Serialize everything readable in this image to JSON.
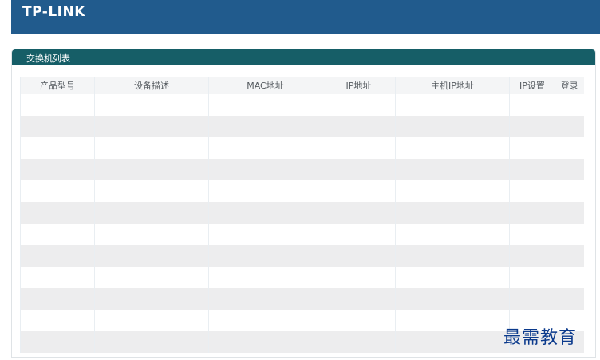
{
  "header": {
    "brand": "TP-LINK",
    "background_color": "#215b8d"
  },
  "panel": {
    "title": "交换机列表",
    "header_color": "#165e67"
  },
  "table": {
    "columns": [
      "产品型号",
      "设备描述",
      "MAC地址",
      "IP地址",
      "主机IP地址",
      "IP设置",
      "登录"
    ],
    "row_count": 12,
    "row_colors": [
      "#ffffff",
      "#ededee"
    ]
  },
  "watermark": {
    "text": "最需教育",
    "color": "#0b3a8c"
  }
}
